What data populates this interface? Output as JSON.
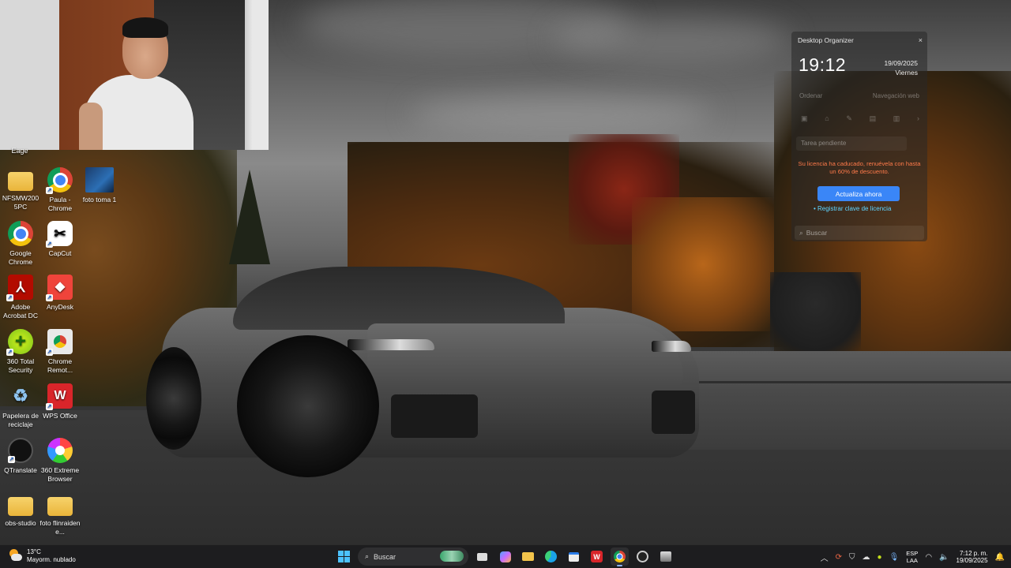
{
  "desktop": {
    "top_cut_label": "Eage",
    "icons": [
      {
        "name": "nfsmw-folder",
        "label": "NFSMW200 5PC",
        "icon": "folder-icon"
      },
      {
        "name": "paula-chrome",
        "label": "Paula - Chrome",
        "icon": "chrome-icon"
      },
      {
        "name": "foto-toma-1",
        "label": "foto toma 1",
        "icon": "image-icon"
      },
      {
        "name": "google-chrome",
        "label": "Google Chrome",
        "icon": "chrome-icon"
      },
      {
        "name": "capcut",
        "label": "CapCut",
        "icon": "capcut-icon"
      },
      {
        "name": "adobe-acrobat",
        "label": "Adobe Acrobat DC",
        "icon": "acrobat-icon"
      },
      {
        "name": "anydesk",
        "label": "AnyDesk",
        "icon": "anydesk-icon"
      },
      {
        "name": "360-total-security",
        "label": "360 Total Security",
        "icon": "shield-plus-icon"
      },
      {
        "name": "chrome-remote",
        "label": "Chrome Remot...",
        "icon": "chrome-remote-icon"
      },
      {
        "name": "recycle-bin",
        "label": "Papelera de reciclaje",
        "icon": "recycle-bin-icon"
      },
      {
        "name": "wps-office",
        "label": "WPS Office",
        "icon": "wps-icon"
      },
      {
        "name": "qtranslate",
        "label": "QTranslate",
        "icon": "qtranslate-icon"
      },
      {
        "name": "360-extreme-browser",
        "label": "360 Extreme Browser",
        "icon": "browser-icon"
      },
      {
        "name": "obs-studio-folder",
        "label": "obs-studio",
        "icon": "folder-icon"
      },
      {
        "name": "foto-flinraiden-folder",
        "label": "foto flinraiden e...",
        "icon": "folder-icon"
      }
    ]
  },
  "organizer": {
    "title": "Desktop Organizer",
    "close": "×",
    "time": "19:12",
    "date": "19/09/2025",
    "weekday": "Viernes",
    "tabs": [
      "Ordenar",
      "Navegación web"
    ],
    "tools": [
      "▣",
      "⌂",
      "✎",
      "▤",
      "▥",
      "›"
    ],
    "task_placeholder": "Tarea pendiente",
    "license_warning": "Su licencia ha caducado, renuévela con hasta un 60% de descuento.",
    "update_button": "Actualiza ahora",
    "register_link": "• Registrar clave de licencia",
    "search_placeholder": "Buscar"
  },
  "taskbar": {
    "weather_temp": "13°C",
    "weather_desc": "Mayorm. nublado",
    "search_label": "Buscar",
    "lang_top": "ESP",
    "lang_bottom": "LAA",
    "clock_time": "7:12 p. m.",
    "clock_date": "19/09/2025",
    "accent": "#4cc2ff"
  }
}
